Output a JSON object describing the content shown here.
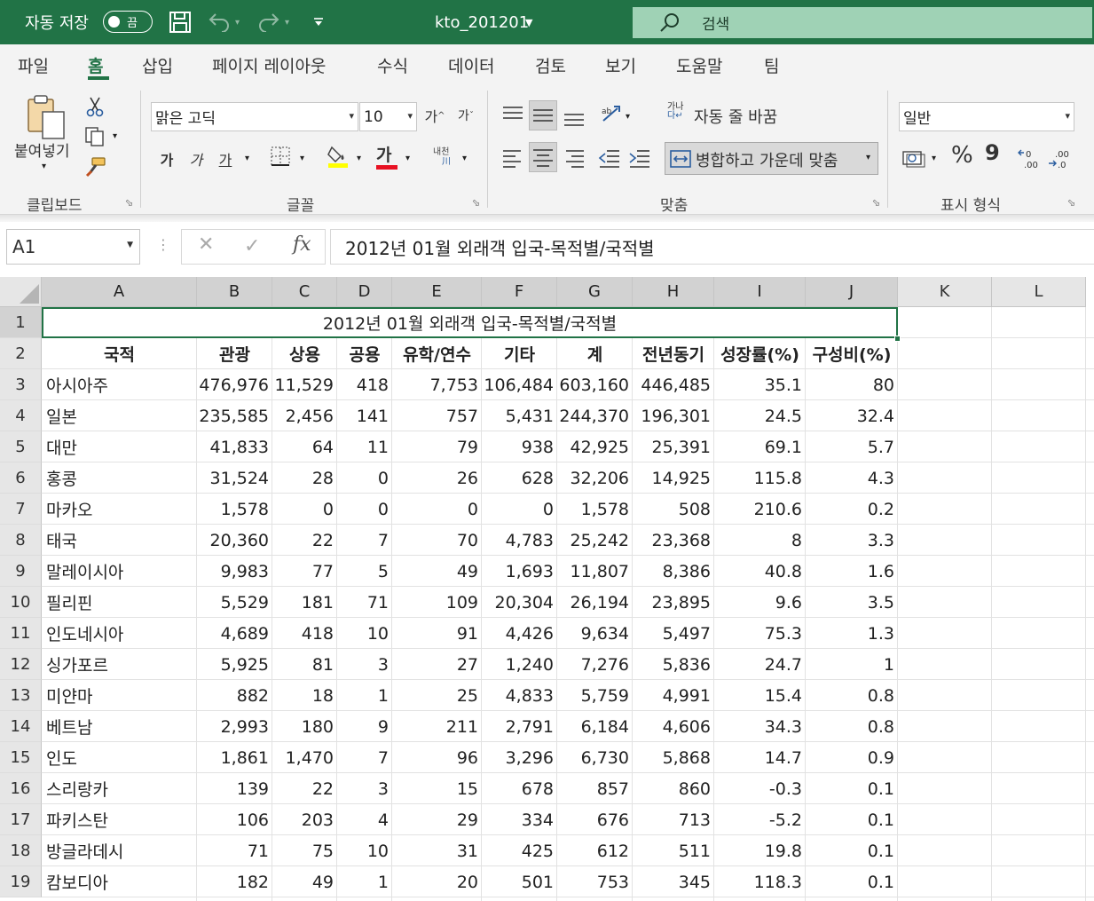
{
  "title_bar": {
    "autosave_label": "자동 저장",
    "autosave_state": "끔",
    "doc_title": "kto_201201",
    "search_placeholder": "검색"
  },
  "tabs": [
    "파일",
    "홈",
    "삽입",
    "페이지 레이아웃",
    "수식",
    "데이터",
    "검토",
    "보기",
    "도움말",
    "팀"
  ],
  "active_tab": "홈",
  "ribbon": {
    "clipboard": {
      "paste_label": "붙여넣기",
      "group_label": "클립보드"
    },
    "font": {
      "font_name": "맑은 고딕",
      "font_size": "10",
      "grow_label": "가",
      "shrink_label": "가",
      "bold_label": "가",
      "italic_label": "가",
      "underline_label": "가",
      "font_color_label": "가",
      "phonetic_label": "내천",
      "group_label": "글꼴"
    },
    "alignment": {
      "wrap_text_label": "자동 줄 바꿈",
      "merge_center_label": "병합하고 가운데 맞춤",
      "group_label": "맞춤"
    },
    "number": {
      "format": "일반",
      "percent_label": "%",
      "comma_label": "9",
      "group_label": "표시 형식"
    }
  },
  "formula_bar": {
    "name_box": "A1",
    "formula": "2012년 01월 외래객 입국-목적별/국적별"
  },
  "columns": [
    "A",
    "B",
    "C",
    "D",
    "E",
    "F",
    "G",
    "H",
    "I",
    "J",
    "K",
    "L"
  ],
  "rows": [
    "1",
    "2",
    "3",
    "4",
    "5",
    "6",
    "7",
    "8",
    "9",
    "10",
    "11",
    "12",
    "13",
    "14",
    "15",
    "16",
    "17",
    "18",
    "19"
  ],
  "sheet": {
    "title": "2012년 01월 외래객 입국-목적별/국적별",
    "headers": [
      "국적",
      "관광",
      "상용",
      "공용",
      "유학/연수",
      "기타",
      "계",
      "전년동기",
      "성장률(%)",
      "구성비(%)"
    ],
    "data": [
      [
        "아시아주",
        "476,976",
        "11,529",
        "418",
        "7,753",
        "106,484",
        "603,160",
        "446,485",
        "35.1",
        "80"
      ],
      [
        "일본",
        "235,585",
        "2,456",
        "141",
        "757",
        "5,431",
        "244,370",
        "196,301",
        "24.5",
        "32.4"
      ],
      [
        "대만",
        "41,833",
        "64",
        "11",
        "79",
        "938",
        "42,925",
        "25,391",
        "69.1",
        "5.7"
      ],
      [
        "홍콩",
        "31,524",
        "28",
        "0",
        "26",
        "628",
        "32,206",
        "14,925",
        "115.8",
        "4.3"
      ],
      [
        "마카오",
        "1,578",
        "0",
        "0",
        "0",
        "0",
        "1,578",
        "508",
        "210.6",
        "0.2"
      ],
      [
        "태국",
        "20,360",
        "22",
        "7",
        "70",
        "4,783",
        "25,242",
        "23,368",
        "8",
        "3.3"
      ],
      [
        "말레이시아",
        "9,983",
        "77",
        "5",
        "49",
        "1,693",
        "11,807",
        "8,386",
        "40.8",
        "1.6"
      ],
      [
        "필리핀",
        "5,529",
        "181",
        "71",
        "109",
        "20,304",
        "26,194",
        "23,895",
        "9.6",
        "3.5"
      ],
      [
        "인도네시아",
        "4,689",
        "418",
        "10",
        "91",
        "4,426",
        "9,634",
        "5,497",
        "75.3",
        "1.3"
      ],
      [
        "싱가포르",
        "5,925",
        "81",
        "3",
        "27",
        "1,240",
        "7,276",
        "5,836",
        "24.7",
        "1"
      ],
      [
        "미얀마",
        "882",
        "18",
        "1",
        "25",
        "4,833",
        "5,759",
        "4,991",
        "15.4",
        "0.8"
      ],
      [
        "베트남",
        "2,993",
        "180",
        "9",
        "211",
        "2,791",
        "6,184",
        "4,606",
        "34.3",
        "0.8"
      ],
      [
        "인도",
        "1,861",
        "1,470",
        "7",
        "96",
        "3,296",
        "6,730",
        "5,868",
        "14.7",
        "0.9"
      ],
      [
        "스리랑카",
        "139",
        "22",
        "3",
        "15",
        "678",
        "857",
        "860",
        "-0.3",
        "0.1"
      ],
      [
        "파키스탄",
        "106",
        "203",
        "4",
        "29",
        "334",
        "676",
        "713",
        "-5.2",
        "0.1"
      ],
      [
        "방글라데시",
        "71",
        "75",
        "10",
        "31",
        "425",
        "612",
        "511",
        "19.8",
        "0.1"
      ],
      [
        "캄보디아",
        "182",
        "49",
        "1",
        "20",
        "501",
        "753",
        "345",
        "118.3",
        "0.1"
      ]
    ]
  },
  "colors": {
    "accent": "#217346",
    "search_bg": "#9fd2b5"
  }
}
